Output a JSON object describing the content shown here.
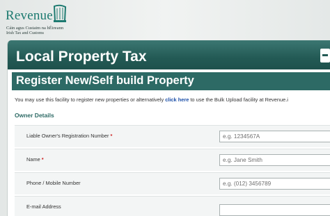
{
  "brand": {
    "name": "Revenue",
    "line1": "Cáin agus Custaim na hÉireann",
    "line2": "Irish Tax and Customs",
    "harp_icon": "harp-emblem-icon",
    "color": "#1d7a70"
  },
  "page": {
    "title": "Local Property Tax"
  },
  "form": {
    "title": "Register New/Self build Property",
    "info_text": "You may use this facility to register new properties or alternatively ",
    "info_link": "click here",
    "info_text_after": " to use the Bulk Upload facility at Revenue.i",
    "section_title": "Owner Details",
    "fields": {
      "registration": {
        "label": "Liable Owner's Registration Number",
        "required_mark": "*",
        "placeholder": "e.g. 1234567A"
      },
      "name": {
        "label": "Name",
        "required_mark": "*",
        "placeholder": "e.g. Jane Smith"
      },
      "phone": {
        "label": "Phone / Mobile Number",
        "placeholder": "e.g. (012) 3456789"
      },
      "email": {
        "label": "E-mail Address",
        "placeholder": ""
      }
    }
  },
  "colors": {
    "header": "#235a55",
    "subheader": "#2d6a65",
    "link": "#1b4fa8",
    "required": "#cc1f1f"
  }
}
